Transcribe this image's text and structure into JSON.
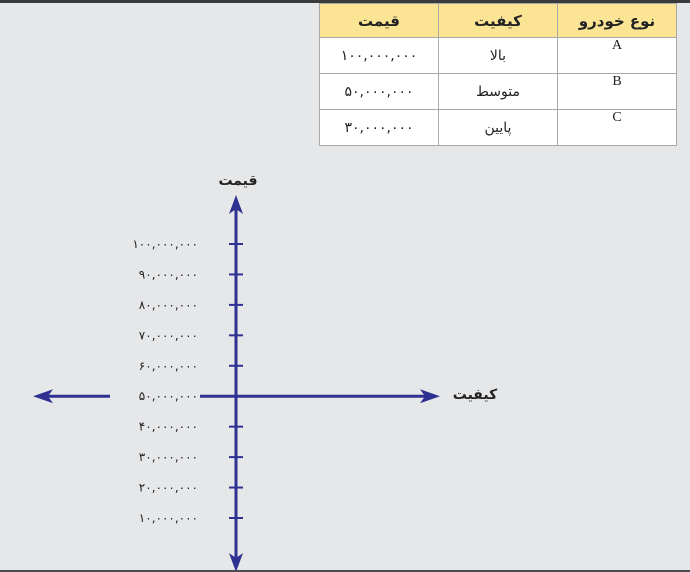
{
  "table": {
    "headers": [
      "نوع خودرو",
      "کیفیت",
      "قیمت"
    ],
    "rows": [
      {
        "car": "A",
        "quality": "بالا",
        "price": "۱۰۰,۰۰۰,۰۰۰"
      },
      {
        "car": "B",
        "quality": "متوسط",
        "price": "۵۰,۰۰۰,۰۰۰"
      },
      {
        "car": "C",
        "quality": "پایین",
        "price": "۳۰,۰۰۰,۰۰۰"
      }
    ],
    "header_color": "#fbe595"
  },
  "chart_data": {
    "type": "scatter",
    "title": "",
    "xlabel": "کیفیت",
    "ylabel": "قیمت",
    "y_ticks": [
      100000000,
      90000000,
      80000000,
      70000000,
      60000000,
      50000000,
      40000000,
      30000000,
      20000000,
      10000000
    ],
    "y_tick_labels": [
      "۱۰۰,۰۰۰,۰۰۰",
      "۹۰,۰۰۰,۰۰۰",
      "۸۰,۰۰۰,۰۰۰",
      "۷۰,۰۰۰,۰۰۰",
      "۶۰,۰۰۰,۰۰۰",
      "۵۰,۰۰۰,۰۰۰",
      "۴۰,۰۰۰,۰۰۰",
      "۳۰,۰۰۰,۰۰۰",
      "۲۰,۰۰۰,۰۰۰",
      "۱۰,۰۰۰,۰۰۰"
    ],
    "x_axis_crosses_y_at": 50000000,
    "ylim": [
      0,
      110000000
    ],
    "points": [],
    "grid": false,
    "axis_color": "#2e3192"
  }
}
